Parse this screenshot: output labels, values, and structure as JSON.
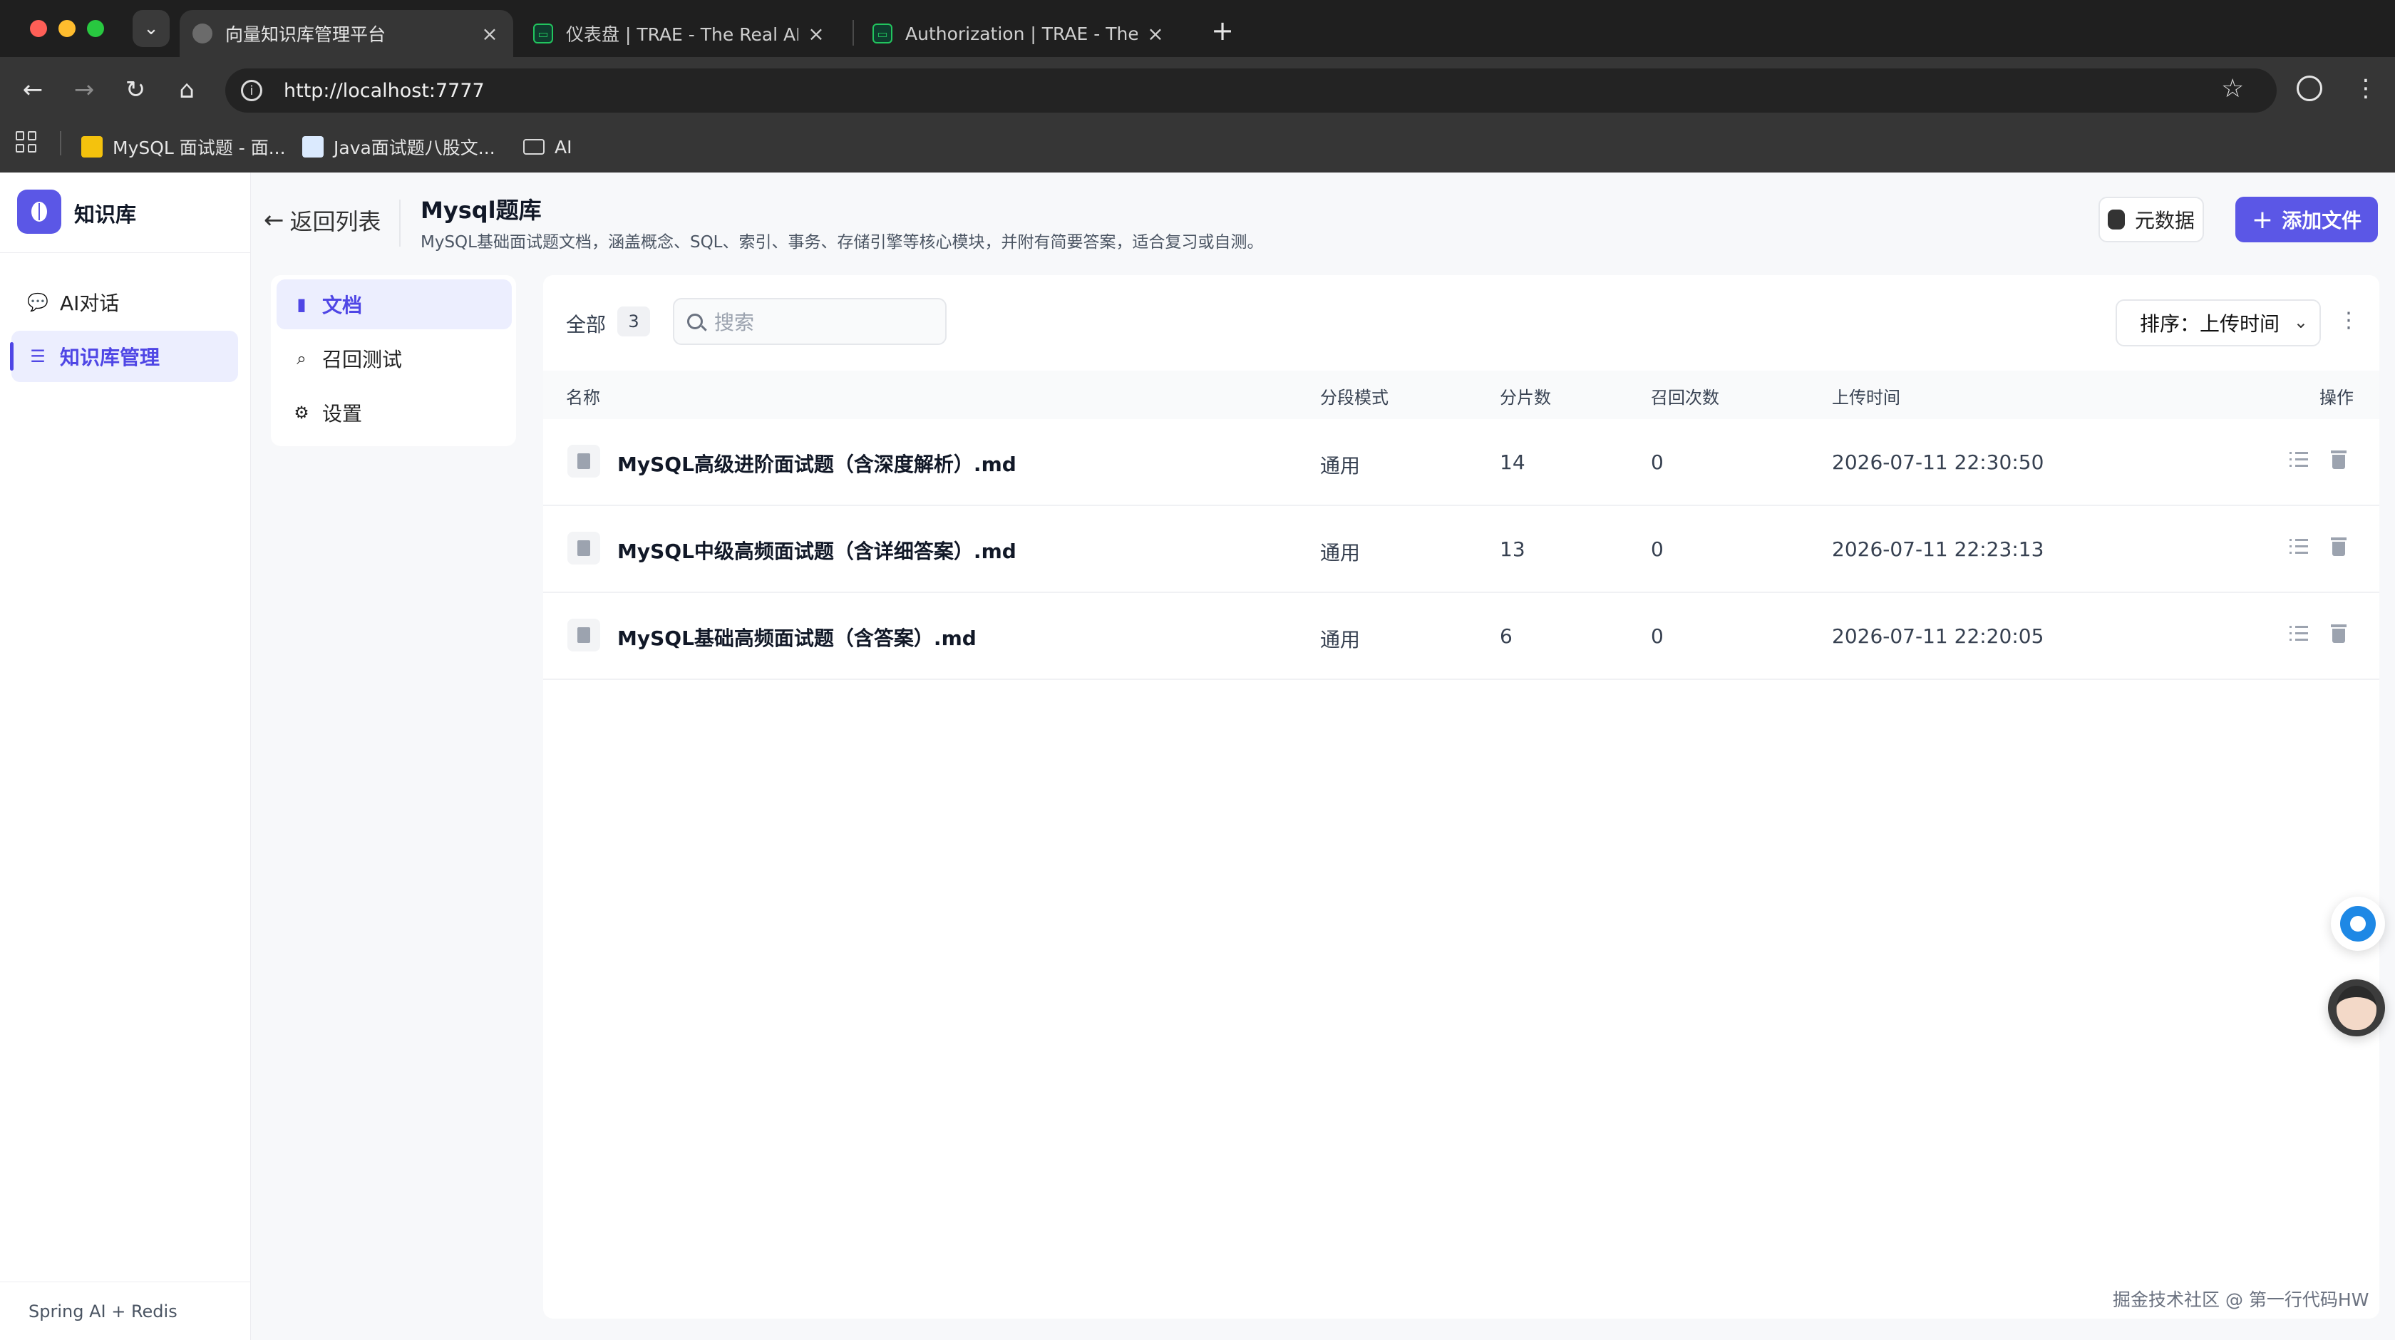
{
  "browser": {
    "tabs": [
      {
        "title": "向量知识库管理平台",
        "active": true
      },
      {
        "title": "仪表盘 | TRAE - The Real AI Eng",
        "active": false
      },
      {
        "title": "Authorization | TRAE - The Real",
        "active": false
      }
    ],
    "url": "http://localhost:7777",
    "bookmarks": [
      {
        "label": "MySQL 面试题 - 面..."
      },
      {
        "label": "Java面试题八股文..."
      },
      {
        "label": "AI"
      }
    ]
  },
  "sidebar": {
    "app_name": "知识库",
    "items": [
      {
        "label": "AI对话",
        "icon": "chat-icon"
      },
      {
        "label": "知识库管理",
        "icon": "list-icon",
        "active": true
      }
    ],
    "footer": "Spring AI + Redis"
  },
  "header": {
    "back_label": "返回列表",
    "title": "Mysql题库",
    "description": "MySQL基础面试题文档，涵盖概念、SQL、索引、事务、存储引擎等核心模块，并附有简要答案，适合复习或自测。",
    "metadata_label": "元数据",
    "add_file_label": "添加文件"
  },
  "inner_nav": [
    {
      "label": "文档",
      "icon": "document-icon",
      "active": true
    },
    {
      "label": "召回测试",
      "icon": "search-icon"
    },
    {
      "label": "设置",
      "icon": "gear-icon"
    }
  ],
  "toolbar": {
    "filter_label": "全部",
    "count": "3",
    "search_placeholder": "搜索",
    "sort_label": "排序：上传时间"
  },
  "table": {
    "headers": {
      "name": "名称",
      "mode": "分段模式",
      "chunks": "分片数",
      "recalls": "召回次数",
      "uploaded": "上传时间",
      "actions": "操作"
    },
    "rows": [
      {
        "name": "MySQL高级进阶面试题（含深度解析）.md",
        "mode": "通用",
        "chunks": "14",
        "recalls": "0",
        "uploaded": "2026-07-11 22:30:50"
      },
      {
        "name": "MySQL中级高频面试题（含详细答案）.md",
        "mode": "通用",
        "chunks": "13",
        "recalls": "0",
        "uploaded": "2026-07-11 22:23:13"
      },
      {
        "name": "MySQL基础高频面试题（含答案）.md",
        "mode": "通用",
        "chunks": "6",
        "recalls": "0",
        "uploaded": "2026-07-11 22:20:05"
      }
    ]
  },
  "watermark": "掘金技术社区 @ 第一行代码HW",
  "colors": {
    "accent": "#5b57e6",
    "active_bg": "#eceefe"
  }
}
